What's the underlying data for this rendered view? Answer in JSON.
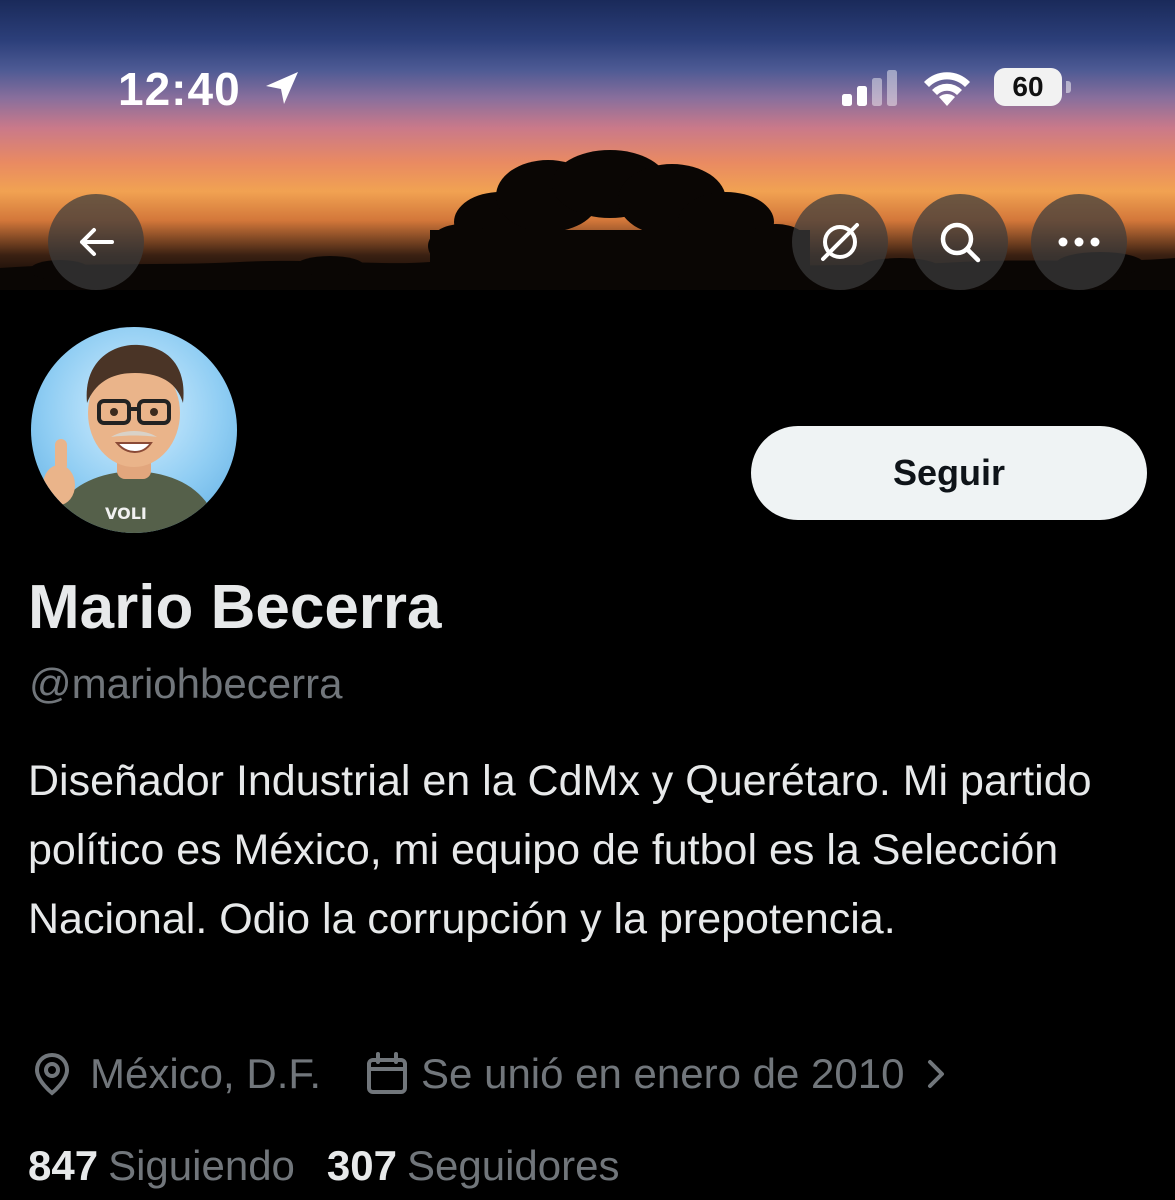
{
  "status_bar": {
    "time": "12:40",
    "battery_level": "60",
    "location_icon": "location-arrow-icon",
    "signal_icon": "cellular-signal-icon",
    "wifi_icon": "wifi-icon"
  },
  "header": {
    "back_icon": "arrow-left-icon",
    "grok_icon": "slash-circle-icon",
    "search_icon": "search-icon",
    "more_icon": "more-horizontal-icon"
  },
  "profile": {
    "display_name": "Mario Becerra",
    "handle": "@mariohbecerra",
    "follow_label": "Seguir",
    "bio": "Diseñador Industrial en la CdMx y Querétaro. Mi partido político es México, mi equipo de futbol es la Selección Nacional. Odio la corrupción y la prepotencia.",
    "location": "México, D.F.",
    "joined": "Se unió en enero de 2010",
    "following_count": "847",
    "following_label": "Siguiendo",
    "followers_count": "307",
    "followers_label": "Seguidores",
    "shirt_text": "VOLI"
  },
  "colors": {
    "background": "#000000",
    "text_primary": "#e7e9ea",
    "text_secondary": "#71767b",
    "button_bg": "#eff3f4",
    "button_text": "#0f1419"
  }
}
